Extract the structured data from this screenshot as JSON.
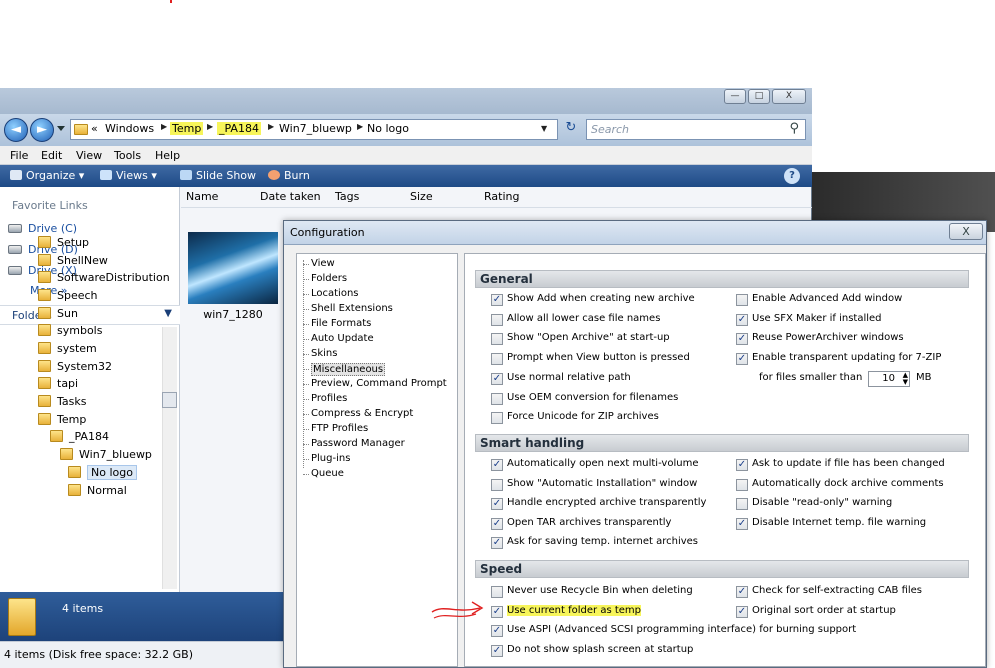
{
  "explorer": {
    "window_buttons": [
      "—",
      "□",
      "X"
    ],
    "breadcrumb": [
      "Windows",
      "Temp",
      "_PA184",
      "Win7_bluewp",
      "No logo"
    ],
    "crumb_prefix": "«",
    "search_placeholder": "Search",
    "menu": [
      "File",
      "Edit",
      "View",
      "Tools",
      "Help"
    ],
    "toolbar": [
      "Organize",
      "Views",
      "Slide Show",
      "Burn"
    ],
    "favorite_links_header": "Favorite Links",
    "favorites": [
      "Drive (C)",
      "Drive (D)",
      "Drive (X)"
    ],
    "more": "More »",
    "folders_header": "Folders",
    "tree": [
      {
        "label": "Setup",
        "level": 0
      },
      {
        "label": "ShellNew",
        "level": 0
      },
      {
        "label": "SoftwareDistribution",
        "level": 0
      },
      {
        "label": "Speech",
        "level": 0
      },
      {
        "label": "Sun",
        "level": 0
      },
      {
        "label": "symbols",
        "level": 0
      },
      {
        "label": "system",
        "level": 0
      },
      {
        "label": "System32",
        "level": 0
      },
      {
        "label": "tapi",
        "level": 0
      },
      {
        "label": "Tasks",
        "level": 0
      },
      {
        "label": "Temp",
        "level": 0
      },
      {
        "label": "_PA184",
        "level": 1
      },
      {
        "label": "Win7_bluewp",
        "level": 2
      },
      {
        "label": "No logo",
        "level": 3
      },
      {
        "label": "Normal",
        "level": 3
      }
    ],
    "columns": [
      "Name",
      "Date taken",
      "Tags",
      "Size",
      "Rating"
    ],
    "file_name": "win7_1280",
    "details_count": "4 items",
    "status": "4 items (Disk free space: 32.2 GB)"
  },
  "config": {
    "title": "Configuration",
    "close": "X",
    "tree": [
      "View",
      "Folders",
      "Locations",
      "Shell Extensions",
      "File Formats",
      "Auto Update",
      "Skins",
      "Miscellaneous",
      "Preview, Command Prompt",
      "Profiles",
      "Compress & Encrypt",
      "FTP Profiles",
      "Password Manager",
      "Plug-ins",
      "Queue"
    ],
    "selected_tree_item": "Miscellaneous",
    "general_title": "General",
    "general_left": [
      {
        "label": "Show Add when creating new archive",
        "checked": true
      },
      {
        "label": "Allow all lower case file names",
        "checked": false
      },
      {
        "label": "Show \"Open Archive\" at start-up",
        "checked": false
      },
      {
        "label": "Prompt when View button is pressed",
        "checked": false
      },
      {
        "label": "Use normal relative path",
        "checked": true
      },
      {
        "label": "Use OEM conversion for filenames",
        "checked": false
      },
      {
        "label": "Force Unicode for ZIP archives",
        "checked": false
      }
    ],
    "general_right": [
      {
        "label": "Enable Advanced Add window",
        "checked": false
      },
      {
        "label": "Use SFX Maker if installed",
        "checked": true
      },
      {
        "label": "Reuse PowerArchiver windows",
        "checked": true
      },
      {
        "label": "Enable transparent updating for 7-ZIP",
        "checked": true
      }
    ],
    "smaller_than_label": "for files smaller than",
    "smaller_than_value": "10",
    "smaller_than_unit": "MB",
    "smart_title": "Smart handling",
    "smart_left": [
      {
        "label": "Automatically open next multi-volume",
        "checked": true
      },
      {
        "label": "Show \"Automatic Installation\" window",
        "checked": false
      },
      {
        "label": "Handle encrypted archive transparently",
        "checked": true
      },
      {
        "label": "Open TAR archives transparently",
        "checked": true
      },
      {
        "label": "Ask for saving temp. internet archives",
        "checked": true
      }
    ],
    "smart_right": [
      {
        "label": "Ask to update if file has been changed",
        "checked": true
      },
      {
        "label": "Automatically dock archive comments",
        "checked": false
      },
      {
        "label": "Disable \"read-only\" warning",
        "checked": false
      },
      {
        "label": "Disable Internet temp. file warning",
        "checked": true
      }
    ],
    "speed_title": "Speed",
    "speed_left": [
      {
        "label": "Never use Recycle Bin when deleting",
        "checked": false
      },
      {
        "label": "Use current folder as temp",
        "checked": true
      },
      {
        "label": "Use ASPI (Advanced SCSI programming interface) for burning support",
        "checked": true
      },
      {
        "label": "Do not show splash screen at startup",
        "checked": true
      }
    ],
    "speed_right": [
      {
        "label": "Check for self-extracting CAB files",
        "checked": true
      },
      {
        "label": "Original sort order at startup",
        "checked": true
      }
    ]
  },
  "colors": {
    "highlight": "#f7f55a",
    "annotation_arrow": "#e02020",
    "toolbar": "#1e4a86"
  }
}
